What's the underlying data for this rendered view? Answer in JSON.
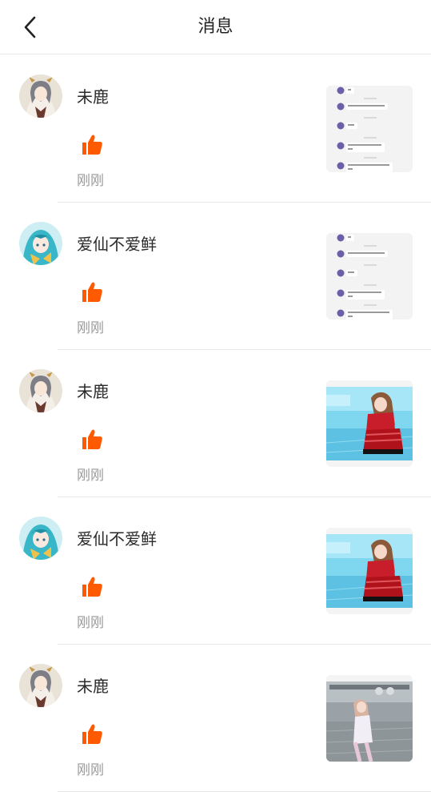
{
  "header": {
    "title": "消息",
    "back_icon": "chevron-left-icon"
  },
  "items": [
    {
      "name": "未鹿",
      "time": "刚刚",
      "avatar": "anime-girl-tan",
      "thumb": "chat-screenshot"
    },
    {
      "name": "爱仙不爱鲜",
      "time": "刚刚",
      "avatar": "anime-girl-teal",
      "thumb": "chat-screenshot"
    },
    {
      "name": "未鹿",
      "time": "刚刚",
      "avatar": "anime-girl-tan",
      "thumb": "game-scene-blue"
    },
    {
      "name": "爱仙不爱鲜",
      "time": "刚刚",
      "avatar": "anime-girl-teal",
      "thumb": "game-scene-blue"
    },
    {
      "name": "未鹿",
      "time": "刚刚",
      "avatar": "anime-girl-tan",
      "thumb": "game-scene-grey"
    }
  ],
  "colors": {
    "like": "#ff5a00",
    "text": "#2a2a2a",
    "muted": "#9a9a9a"
  }
}
